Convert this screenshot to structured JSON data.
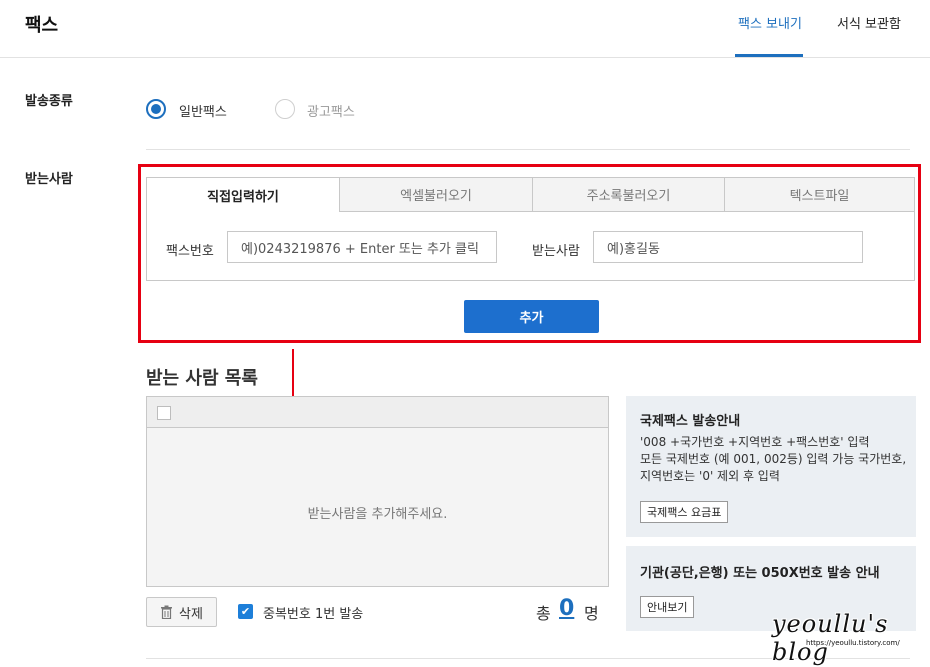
{
  "header": {
    "title": "팩스",
    "tabs": [
      {
        "label": "팩스 보내기",
        "active": true
      },
      {
        "label": "서식 보관함",
        "active": false
      }
    ]
  },
  "send_type": {
    "label": "발송종류",
    "options": [
      {
        "label": "일반팩스",
        "checked": true
      },
      {
        "label": "광고팩스",
        "checked": false
      }
    ]
  },
  "recipient": {
    "label": "받는사람",
    "subtabs": [
      {
        "label": "직접입력하기",
        "active": true
      },
      {
        "label": "엑셀불러오기",
        "active": false
      },
      {
        "label": "주소록불러오기",
        "active": false
      },
      {
        "label": "텍스트파일",
        "active": false
      }
    ],
    "fax_label": "팩스번호",
    "fax_placeholder": "예)0243219876 + Enter 또는 추가 클릭",
    "name_label": "받는사람",
    "name_placeholder": "예)홍길동",
    "add_button": "추가"
  },
  "recipient_list": {
    "title": "받는 사람 목록",
    "empty_message": "받는사람을 추가해주세요.",
    "delete_button": "삭제",
    "dedupe_label": "중복번호 1번 발송",
    "dedupe_checked": true,
    "total_prefix": "총",
    "total_count": "0",
    "total_suffix": "명"
  },
  "info_international": {
    "title": "국제팩스 발송안내",
    "lines": [
      "'008 +국가번호 +지역번호 +팩스번호' 입력",
      "모든 국제번호 (예 001, 002등) 입력 가능 국가번호, 지역번호는 '0' 제외 후 입력"
    ],
    "button": "국제팩스 요금표"
  },
  "info_050": {
    "title": "기관(공단,은행) 또는 050X번호 발송 안내",
    "button": "안내보기"
  },
  "watermark": {
    "text": "yeoullu's blog",
    "url": "https://yeoullu.tistory.com/"
  },
  "colors": {
    "accent": "#1d6fbe",
    "highlight": "#e60012",
    "info_bg": "#ebeff3"
  }
}
